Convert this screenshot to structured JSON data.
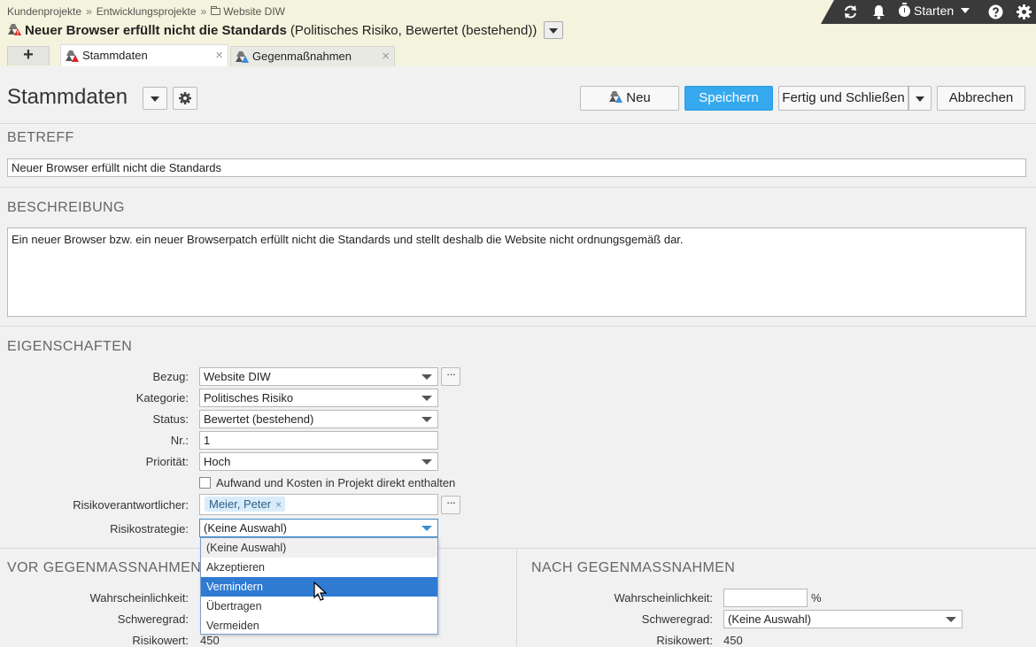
{
  "breadcrumb": {
    "items": [
      "Kundenprojekte",
      "Entwicklungsprojekte",
      "Website DIW"
    ],
    "separator": "»"
  },
  "header": {
    "title_main": "Neuer Browser erfüllt nicht die Standards",
    "title_sub": "(Politisches Risiko, Bewertet (bestehend))"
  },
  "toolbar": {
    "starten_label": "Starten",
    "icons": [
      "refresh-icon",
      "bell-icon",
      "stopwatch-icon",
      "help-icon",
      "gear-icon"
    ]
  },
  "tabs": [
    {
      "label": "Stammdaten",
      "active": true
    },
    {
      "label": "Gegenmaßnahmen",
      "active": false
    }
  ],
  "tab_add_label": "+",
  "tab_close_glyph": "×",
  "page": {
    "title": "Stammdaten",
    "buttons": {
      "neu": "Neu",
      "speichern": "Speichern",
      "fertig": "Fertig und Schließen",
      "abbrechen": "Abbrechen"
    }
  },
  "betreff": {
    "heading": "BETREFF",
    "value": "Neuer Browser erfüllt nicht die Standards"
  },
  "beschreibung": {
    "heading": "BESCHREIBUNG",
    "value": "Ein neuer Browser bzw. ein neuer Browserpatch erfüllt nicht die Standards und stellt deshalb die Website nicht ordnungsgemäß dar."
  },
  "eigenschaften": {
    "heading": "EIGENSCHAFTEN",
    "bezug": {
      "label": "Bezug:",
      "value": "Website DIW"
    },
    "kategorie": {
      "label": "Kategorie:",
      "value": "Politisches Risiko"
    },
    "status": {
      "label": "Status:",
      "value": "Bewertet (bestehend)"
    },
    "nr": {
      "label": "Nr.:",
      "value": "1"
    },
    "prioritaet": {
      "label": "Priorität:",
      "value": "Hoch"
    },
    "checkbox_label": "Aufwand und Kosten in Projekt direkt enthalten",
    "risikoverantwortlicher": {
      "label": "Risikoverantwortlicher:",
      "value": "Meier, Peter"
    },
    "risikostrategie": {
      "label": "Risikostrategie:",
      "value": "(Keine Auswahl)",
      "options": [
        "(Keine Auswahl)",
        "Akzeptieren",
        "Vermindern",
        "Übertragen",
        "Vermeiden"
      ],
      "highlighted": "Vermindern"
    },
    "dots_label": "···"
  },
  "vor": {
    "heading": "VOR GEGENMASSNAHMEN",
    "wahrscheinlichkeit_label": "Wahrscheinlichkeit:",
    "schweregrad_label": "Schweregrad:",
    "risikowert_label": "Risikowert:",
    "risikowert": "450"
  },
  "nach": {
    "heading": "NACH GEGENMASSNAHMEN",
    "wahrscheinlichkeit_label": "Wahrscheinlichkeit:",
    "wahrscheinlichkeit": "",
    "percent": "%",
    "schweregrad_label": "Schweregrad:",
    "schweregrad": "(Keine Auswahl)",
    "risikowert_label": "Risikowert:",
    "risikowert": "450"
  },
  "colors": {
    "header_bg": "#f4f3dd",
    "toolbar_bg": "#3a3a3a",
    "primary": "#36a9ee",
    "highlight": "#2f7bd2"
  }
}
